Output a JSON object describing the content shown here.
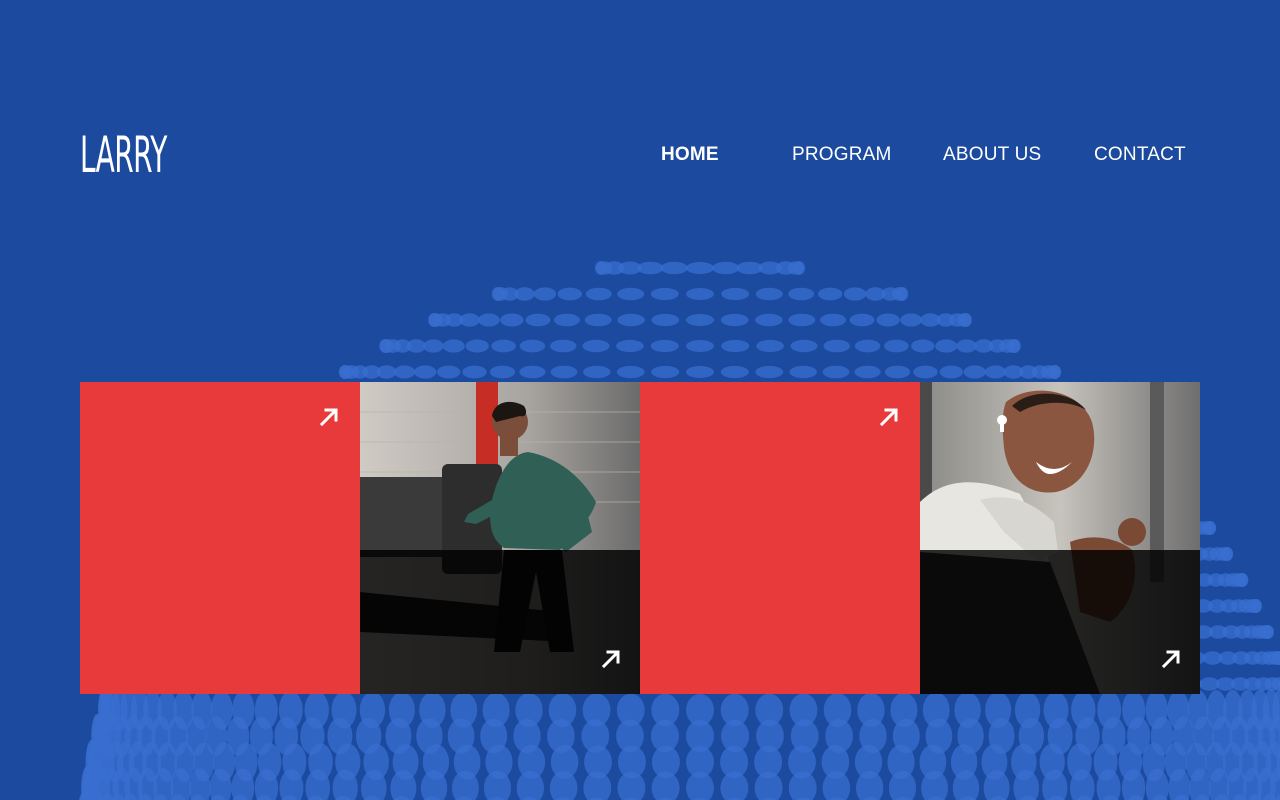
{
  "header": {
    "logo": "LARRY",
    "nav": [
      {
        "label": "HOME",
        "active": true
      },
      {
        "label": "PROGRAM",
        "active": false
      },
      {
        "label": "ABOUT US",
        "active": false
      },
      {
        "label": "CONTACT",
        "active": false
      }
    ]
  },
  "cards": [
    {
      "kind": "color-tile",
      "icon": "arrow-up-right-icon"
    },
    {
      "kind": "photo",
      "subject": "man running on treadmill in gym",
      "icon": "arrow-up-right-icon"
    },
    {
      "kind": "color-tile",
      "icon": "arrow-up-right-icon"
    },
    {
      "kind": "photo",
      "subject": "smiling man with towel flexing arm",
      "icon": "arrow-up-right-icon"
    }
  ],
  "colors": {
    "background": "#1b4a9e",
    "dots": "#3a6fd0",
    "accent_red": "#e83a3a",
    "text": "#ffffff"
  }
}
